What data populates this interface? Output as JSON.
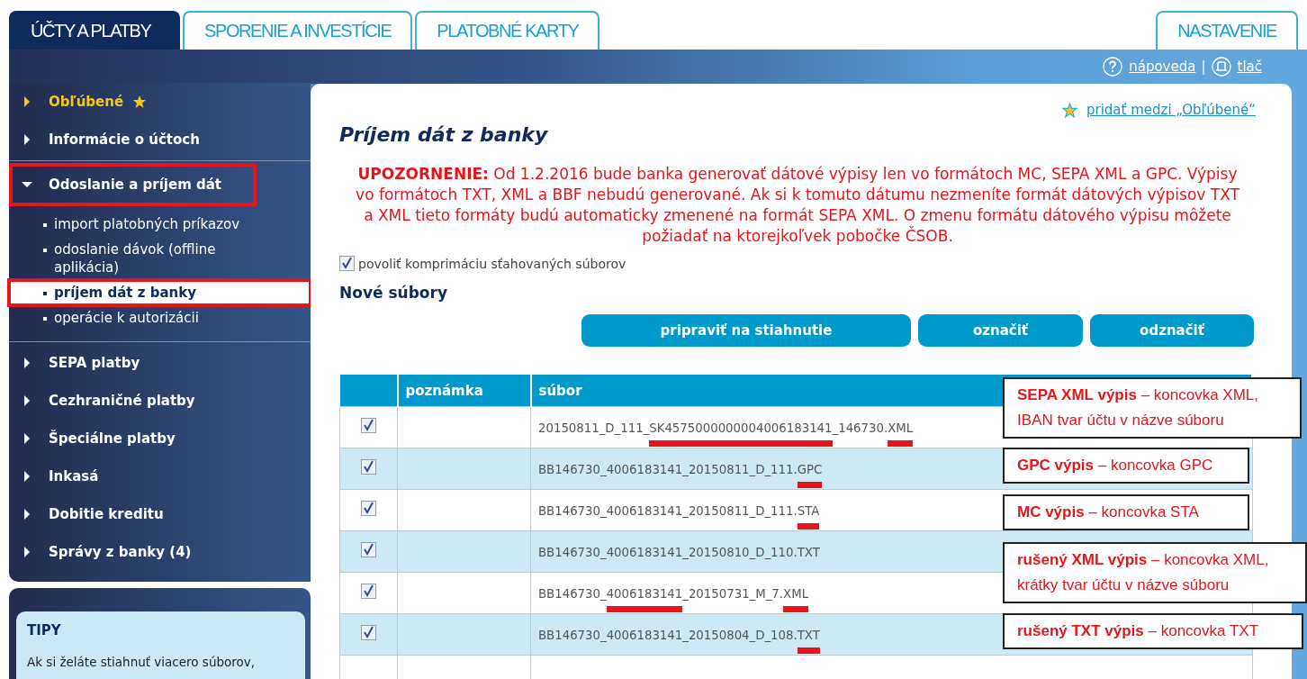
{
  "tabs": [
    {
      "label": "ÚČTY A PLATBY",
      "selected": true
    },
    {
      "label": "SPORENIE A INVESTÍCIE",
      "selected": false
    },
    {
      "label": "PLATOBNÉ KARTY",
      "selected": false
    }
  ],
  "settings_tab": {
    "label": "NASTAVENIE",
    "selected": false
  },
  "toolbar": {
    "help_link": "nápoveda",
    "separator": "|",
    "print_link": "tlač"
  },
  "sidebar": {
    "items": [
      {
        "label": "Obľúbené",
        "kind": "favorite",
        "expanded": false,
        "annotated": false
      },
      {
        "label": "Informácie o účtoch",
        "kind": "section",
        "expanded": false,
        "annotated": false
      },
      {
        "label": "Odoslanie a príjem dát",
        "kind": "section",
        "expanded": true,
        "annotated": true,
        "children": [
          {
            "label": "import platobných príkazov",
            "selected": false,
            "annotated": false
          },
          {
            "label": "odoslanie dávok (offline aplikácia)",
            "selected": false,
            "annotated": false
          },
          {
            "label": "príjem dát z banky",
            "selected": true,
            "annotated": true
          },
          {
            "label": "operácie k autorizácii",
            "selected": false,
            "annotated": false
          }
        ]
      },
      {
        "label": "SEPA platby",
        "kind": "section",
        "expanded": false,
        "annotated": false
      },
      {
        "label": "Cezhraničné platby",
        "kind": "section",
        "expanded": false,
        "annotated": false
      },
      {
        "label": "Špeciálne platby",
        "kind": "section",
        "expanded": false,
        "annotated": false
      },
      {
        "label": "Inkasá",
        "kind": "section",
        "expanded": false,
        "annotated": false
      },
      {
        "label": "Dobitie kreditu",
        "kind": "section",
        "expanded": false,
        "annotated": false
      },
      {
        "label": "Správy z banky (4)",
        "kind": "section",
        "expanded": false,
        "annotated": false
      }
    ]
  },
  "tips": {
    "title": "TIPY",
    "text": "Ak si želáte stiahnuť viacero súborov,"
  },
  "main": {
    "favorite_link": "pridať medzi „Obľúbené“",
    "title": "Príjem dát z banky",
    "warning": "**UPOZORNENIE:** Od 1.2.2016 bude banka generovať dátové výpisy len vo formátoch MC, SEPA XML a GPC. Výpisy vo formátoch TXT, XML a BBF nebudú generované. Ak si k tomuto dátumu nezmeníte formát dátových výpisov TXT a XML tieto formáty budú automaticky zmenené na formát SEPA XML. O zmenu formátu dátového výpisu môžete požiadať na ktorejkoľvek pobočke ČSOB.",
    "compress": {
      "label": "povoliť komprimáciu sťahovaných súborov",
      "checked": true
    },
    "section_title": "Nové súbory",
    "buttons": [
      "pripraviť na stiahnutie",
      "označiť",
      "odznačiť"
    ],
    "table": {
      "columns": [
        "poznámka",
        "súbor"
      ],
      "rows": [
        {
          "checked": true,
          "file": [
            {
              "text": "20150811_D_111_",
              "underlined": false
            },
            {
              "text": "SK4575000000004006183141",
              "underlined": true
            },
            {
              "text": "_146730.",
              "underlined": false
            },
            {
              "text": "XML",
              "underlined": true
            }
          ]
        },
        {
          "checked": true,
          "file": [
            {
              "text": "BB146730_4006183141_20150811_D_111.",
              "underlined": false
            },
            {
              "text": "GPC",
              "underlined": true
            }
          ]
        },
        {
          "checked": true,
          "file": [
            {
              "text": "BB146730_4006183141_20150811_D_111.",
              "underlined": false
            },
            {
              "text": "STA",
              "underlined": true
            }
          ]
        },
        {
          "checked": true,
          "file": [
            {
              "text": "BB146730_4006183141_20150810_D_110.TXT",
              "underlined": false
            }
          ]
        },
        {
          "checked": true,
          "file": [
            {
              "text": "BB146730_",
              "underlined": false
            },
            {
              "text": "4006183141",
              "underlined": true
            },
            {
              "text": "_20150731_M_7.",
              "underlined": false
            },
            {
              "text": "XML",
              "underlined": true
            }
          ]
        },
        {
          "checked": true,
          "file": [
            {
              "text": "BB146730_4006183141_20150804_D_108.",
              "underlined": false
            },
            {
              "text": "TXT",
              "underlined": true
            }
          ]
        }
      ]
    },
    "callouts": [
      "**SEPA XML výpis** – koncovka XML, IBAN tvar účtu v názve súboru",
      "**GPC výpis** – koncovka GPC",
      "**MC výpis** – koncovka STA",
      "**rušený XML výpis** – koncovka XML, krátky tvar účtu v názve súboru",
      "**rušený TXT výpis** – koncovka TXT"
    ]
  }
}
